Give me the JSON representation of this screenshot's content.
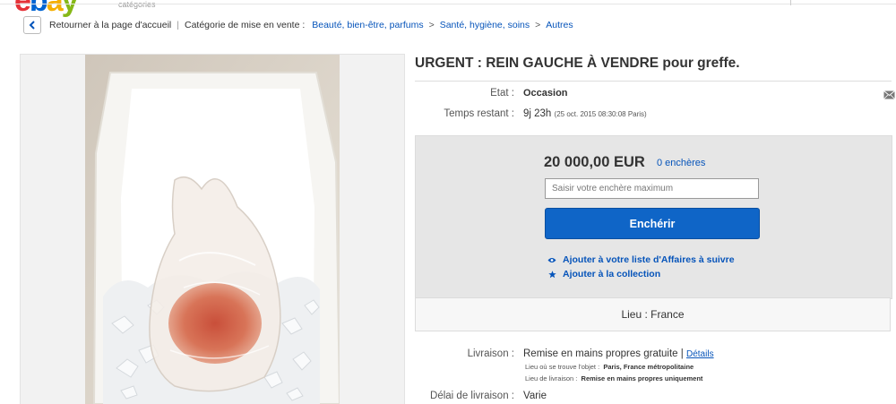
{
  "header": {
    "logo": [
      "e",
      "b",
      "a",
      "y"
    ],
    "categories_label": "catégories"
  },
  "breadcrumb": {
    "back_label": "Retourner à la page d'accueil",
    "separator": "|",
    "category_prefix": "Catégorie de mise en vente :",
    "items": [
      "Beauté, bien-être, parfums",
      "Santé, hygiène, soins",
      "Autres"
    ],
    "arrow": ">"
  },
  "item": {
    "title": "URGENT : REIN GAUCHE À VENDRE pour greffe.",
    "etat_label": "Etat :",
    "etat_value": "Occasion",
    "temps_label": "Temps restant :",
    "temps_value": "9j 23h",
    "temps_detail": "(25 oct. 2015   08:30:08 Paris)"
  },
  "bid": {
    "price": "20 000,00 EUR",
    "bids_count": "0 enchères",
    "input_placeholder": "Saisir votre enchère maximum",
    "input_value": "",
    "button_label": "Enchérir",
    "watchlist_label": "Ajouter à votre liste d'Affaires à suivre",
    "collection_label": "Ajouter à la collection"
  },
  "location": {
    "text": "Lieu : France"
  },
  "shipping": {
    "livraison_label": "Livraison :",
    "livraison_value": "Remise en mains propres gratuite",
    "separator": "|",
    "details_link": "Détails",
    "object_location_label": "Lieu où se trouve l'objet :",
    "object_location_value": "Paris, France métropolitaine",
    "delivery_place_label": "Lieu de livraison :",
    "delivery_place_value": "Remise en mains propres uniquement",
    "delai_label": "Délai de livraison :",
    "delai_value": "Varie"
  },
  "icons": {
    "back": "chevron-left-icon",
    "watch": "eye-icon",
    "collection": "star-icon",
    "email": "email-icon"
  },
  "colors": {
    "link": "#0654ba",
    "button": "#0f65c7",
    "bid_panel": "#e6e6e6"
  }
}
